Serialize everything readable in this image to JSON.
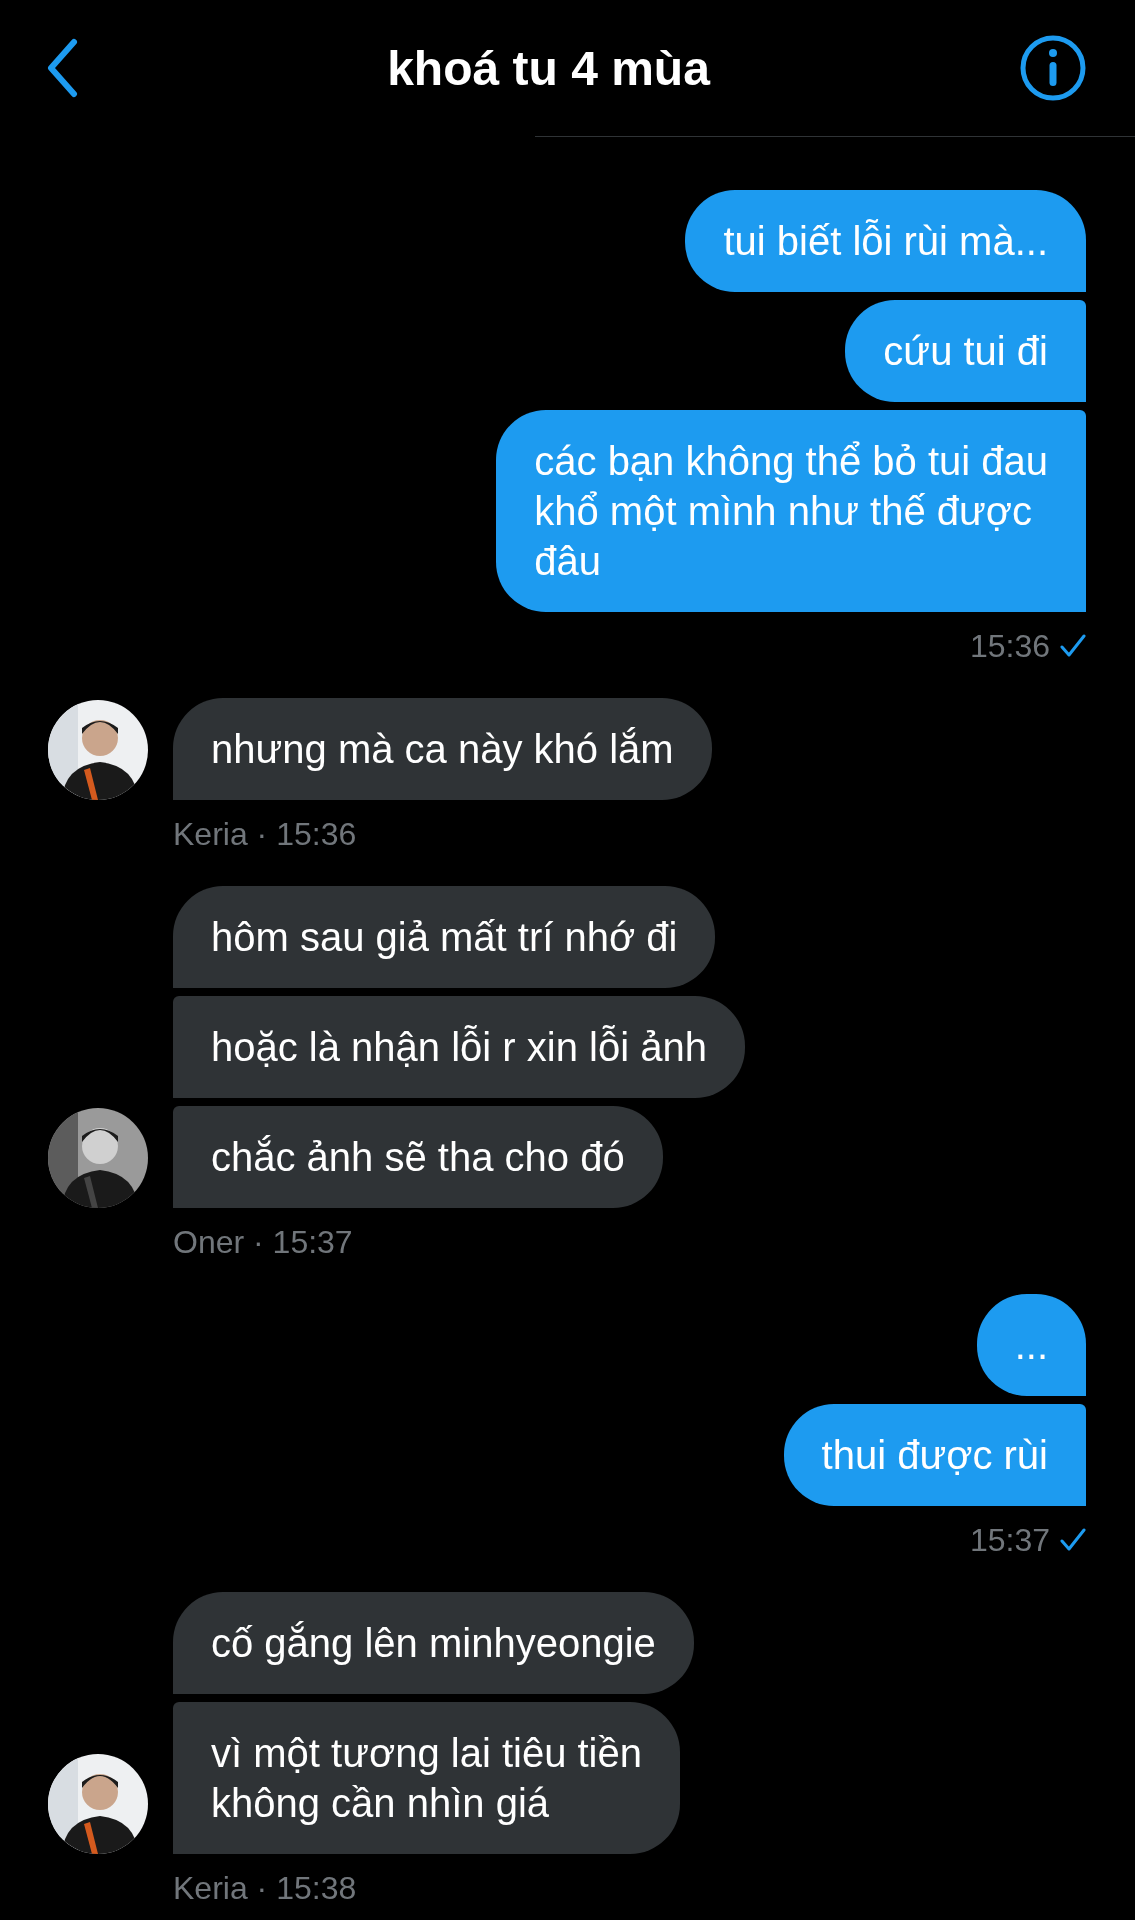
{
  "header": {
    "title": "khoá tu 4 mùa"
  },
  "groups": [
    {
      "kind": "sent",
      "messages": [
        "tui biết lỗi rùi mà...",
        "cứu tui đi",
        "các bạn không thể bỏ tui đau\nkhổ một mình như thế được\nđâu"
      ],
      "time": "15:36",
      "read": true
    },
    {
      "kind": "received",
      "messages": [
        "nhưng mà ca này khó lắm"
      ],
      "sender": "Keria",
      "separator": "·",
      "time": "15:36"
    },
    {
      "kind": "received",
      "messages": [
        "hôm sau giả mất trí nhớ đi",
        "hoặc là nhận lỗi r xin lỗi ảnh",
        "chắc ảnh sẽ tha cho đó"
      ],
      "sender": "Oner",
      "separator": "·",
      "time": "15:37"
    },
    {
      "kind": "sent",
      "messages": [
        "...",
        "thui được rùi"
      ],
      "time": "15:37",
      "read": true
    },
    {
      "kind": "received",
      "messages": [
        "cố gắng lên minhyeongie",
        "vì một tương lai tiêu tiền\nkhông cần nhìn giá"
      ],
      "sender": "Keria",
      "separator": "·",
      "time": "15:38"
    }
  ]
}
